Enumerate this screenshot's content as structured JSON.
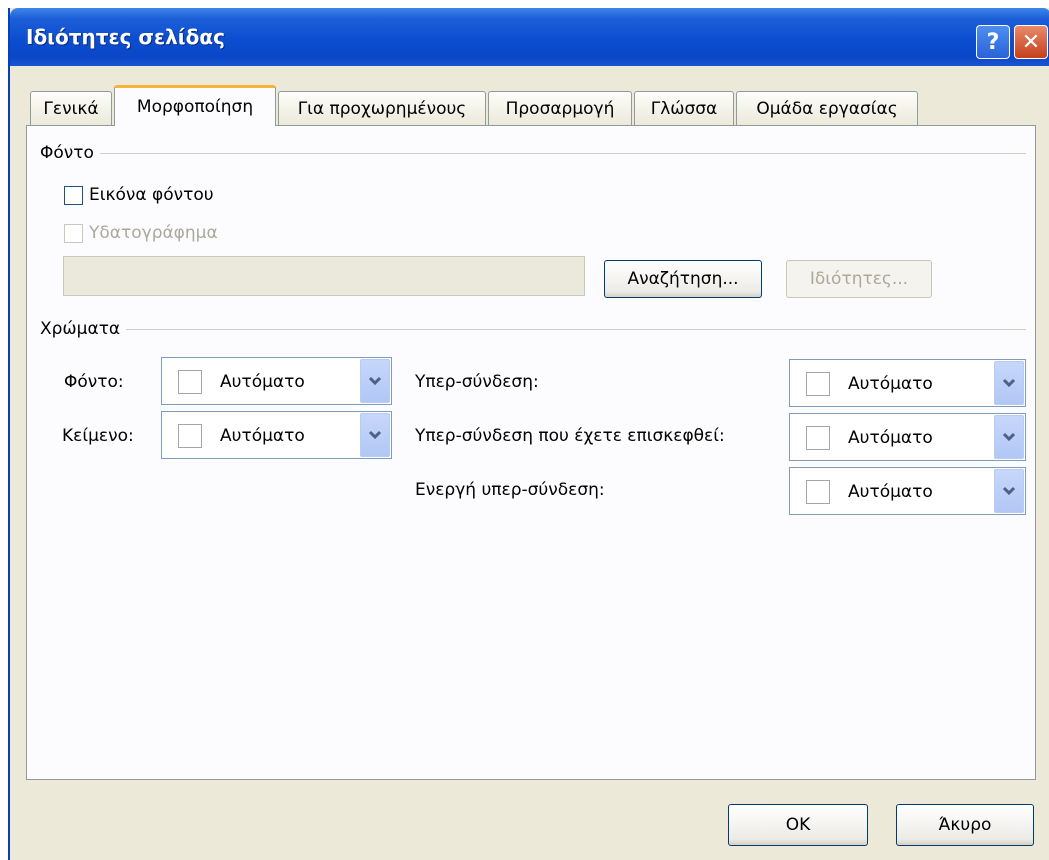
{
  "window": {
    "title": "Ιδιότητες σελίδας",
    "help_glyph": "?",
    "close_glyph": "✕"
  },
  "tabs": [
    {
      "label": "Γενικά",
      "active": false
    },
    {
      "label": "Μορφοποίηση",
      "active": true
    },
    {
      "label": "Για προχωρημένους",
      "active": false
    },
    {
      "label": "Προσαρμογή",
      "active": false
    },
    {
      "label": "Γλώσσα",
      "active": false
    },
    {
      "label": "Ομάδα εργασίας",
      "active": false
    }
  ],
  "background_group": {
    "label": "Φόντο",
    "background_image": {
      "label": "Εικόνα φόντου",
      "checked": false,
      "enabled": true
    },
    "watermark": {
      "label": "Υδατογράφημα",
      "checked": false,
      "enabled": false
    },
    "path_value": "",
    "browse_label": "Αναζήτηση...",
    "properties_label": "Ιδιότητες..."
  },
  "colors_group": {
    "label": "Χρώματα",
    "background": {
      "label": "Φόντο:",
      "value": "Αυτόματο"
    },
    "text": {
      "label": "Κείμενο:",
      "value": "Αυτόματο"
    },
    "hyperlink": {
      "label": "Υπερ-σύνδεση:",
      "value": "Αυτόματο"
    },
    "visited_hyperlink": {
      "label": "Υπερ-σύνδεση που έχετε επισκεφθεί:",
      "value": "Αυτόματο"
    },
    "active_hyperlink": {
      "label": "Ενεργή υπερ-σύνδεση:",
      "value": "Αυτόματο"
    }
  },
  "footer": {
    "ok_label": "OK",
    "cancel_label": "Άκυρο"
  },
  "colors": {
    "titlebar": "#0a47c8",
    "face": "#ece9d8",
    "active_tab_highlight": "#f7b23a"
  }
}
